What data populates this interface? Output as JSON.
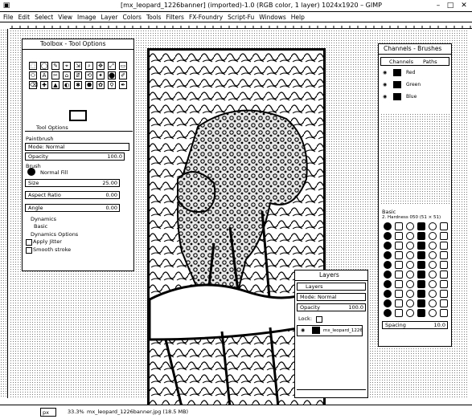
{
  "window": {
    "title": "[mx_leopard_1226banner] (imported)-1.0 (RGB color, 1 layer) 1024x1920 – GIMP"
  },
  "menu": [
    "File",
    "Edit",
    "Select",
    "View",
    "Image",
    "Layer",
    "Colors",
    "Tools",
    "Filters",
    "FX-Foundry",
    "Script-Fu",
    "Windows",
    "Help"
  ],
  "toolbox": {
    "title": "Toolbox - Tool Options",
    "tool_options_tab": "Tool Options",
    "tool_name": "Paintbrush",
    "mode_label": "Mode: Normal",
    "opacity_label": "Opacity",
    "opacity_value": "100.0",
    "brush_label": "Brush",
    "brush_name": "Normal Fill",
    "size_label": "Size",
    "size_value": "25.00",
    "aspect_label": "Aspect Ratio",
    "aspect_value": "0.00",
    "angle_label": "Angle",
    "angle_value": "0.00",
    "dynamics_label": "Dynamics",
    "dynamics_name": "Basic",
    "dyn_options_label": "Dynamics Options",
    "apply_jitter_label": "Apply Jitter",
    "smooth_stroke_label": "Smooth stroke"
  },
  "channels": {
    "title": "Channels - Brushes",
    "tab_channels": "Channels",
    "tab_paths": "Paths",
    "rows": [
      "Red",
      "Green",
      "Blue"
    ]
  },
  "brushes": {
    "filter_label": "Basic",
    "preset_label": "2. Hardness 050 (51 × 51)",
    "spacing_label": "Spacing",
    "spacing_value": "10.0"
  },
  "layers": {
    "title": "Layers",
    "tab": "Layers",
    "mode_label": "Mode: Normal",
    "opacity_label": "Opacity",
    "opacity_value": "100.0",
    "lock_label": "Lock:",
    "layer_name": "mx_leopard_1226"
  },
  "status": {
    "unit": "px",
    "zoom": "33.3%",
    "file_info": "mx_leopard_1226banner.jpg (18.5 MB)"
  }
}
